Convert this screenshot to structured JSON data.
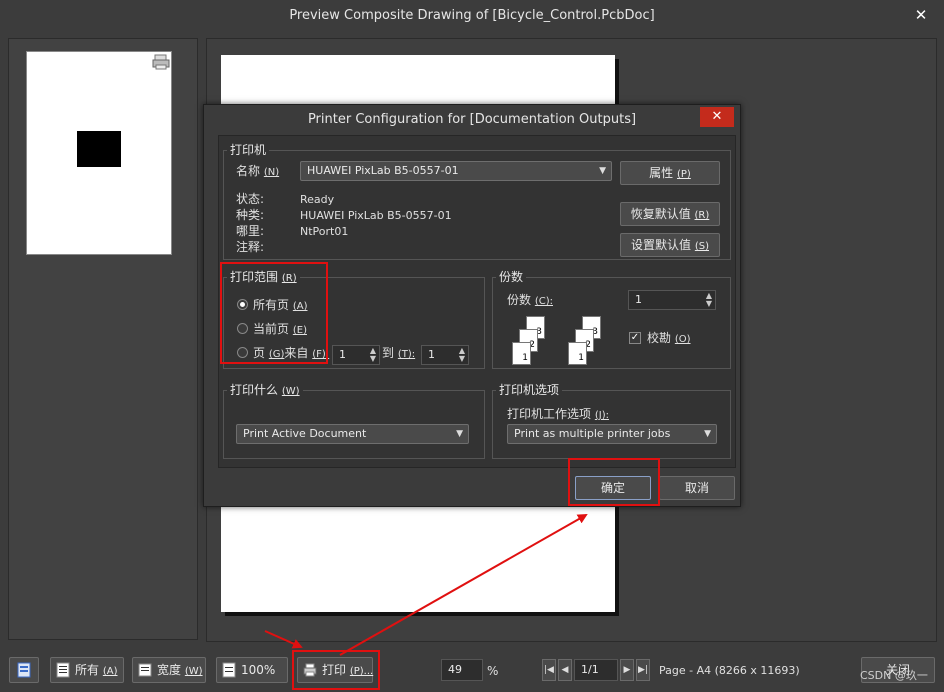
{
  "window": {
    "title": "Preview Composite Drawing of [Bicycle_Control.PcbDoc]",
    "close_glyph": "✕"
  },
  "dialog": {
    "title": "Printer Configuration for [Documentation Outputs]",
    "close_glyph": "✕",
    "printer_group": {
      "title": "打印机",
      "name_label": "名称",
      "name_mnemonic": "(N)",
      "name_value": "HUAWEI PixLab B5-0557-01",
      "properties_button": "属性",
      "properties_mnemonic": "(P)",
      "status_label": "状态:",
      "status_value": "Ready",
      "type_label": "种类:",
      "type_value": "HUAWEI PixLab B5-0557-01",
      "where_label": "哪里:",
      "where_value": "NtPort01",
      "comment_label": "注释:",
      "restore_defaults_button": "恢复默认值",
      "restore_defaults_mnemonic": "(R)",
      "set_defaults_button": "设置默认值",
      "set_defaults_mnemonic": "(S)"
    },
    "range_group": {
      "title": "打印范围",
      "title_mnemonic": "(R)",
      "all_pages": "所有页",
      "all_pages_mnemonic": "(A)",
      "current_page": "当前页",
      "current_page_mnemonic": "(E)",
      "pages": "页",
      "pages_mnemonic": "(G)",
      "from_label": "来自",
      "from_mnemonic": "(F):",
      "from_value": "1",
      "to_label": "到",
      "to_mnemonic": "(T):",
      "to_value": "1",
      "selected": "all_pages"
    },
    "copies_group": {
      "title": "份数",
      "copies_label": "份数",
      "copies_mnemonic": "(C):",
      "copies_value": "1",
      "collate_label": "校勘",
      "collate_mnemonic": "(O)",
      "collate_checked": true,
      "page_numbers": [
        "3",
        "2",
        "1"
      ]
    },
    "what_group": {
      "title": "打印什么",
      "title_mnemonic": "(W)",
      "value": "Print Active Document"
    },
    "options_group": {
      "title": "打印机选项",
      "job_label": "打印机工作选项",
      "job_mnemonic": "(J):",
      "job_value": "Print as multiple printer jobs"
    },
    "ok_button": "确定",
    "cancel_button": "取消"
  },
  "toolbar": {
    "all_label": "所有",
    "all_mnemonic": "(A)",
    "width_label": "宽度",
    "width_mnemonic": "(W)",
    "zoom100_label": "100%",
    "print_label": "打印",
    "print_mnemonic": "(P)...",
    "zoom_value": "49",
    "zoom_unit": "%",
    "page_value": "1/1",
    "page_info": "Page - A4 (8266 x 11693)",
    "close_label": "关闭",
    "watermark": "CSDN @玖一"
  },
  "colors": {
    "highlight": "#e01010",
    "close_red": "#c42b1c"
  }
}
